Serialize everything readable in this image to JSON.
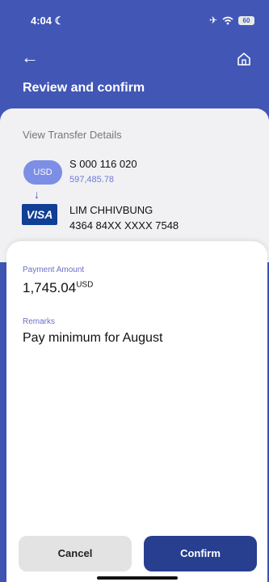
{
  "status_bar": {
    "time": "4:04",
    "battery": "60"
  },
  "header": {
    "title": "Review and confirm"
  },
  "details": {
    "section_label": "View Transfer Details",
    "from": {
      "currency_badge": "USD",
      "account_number": "S 000 116 020",
      "balance": "597,485.78"
    },
    "to": {
      "card_brand": "VISA",
      "name": "LIM CHHIVBUNG",
      "card_number": "4364 84XX XXXX 7548"
    }
  },
  "payment": {
    "amount_label": "Payment Amount",
    "amount": "1,745.04",
    "currency": "USD",
    "remarks_label": "Remarks",
    "remarks": "Pay minimum for August"
  },
  "actions": {
    "cancel": "Cancel",
    "confirm": "Confirm"
  }
}
